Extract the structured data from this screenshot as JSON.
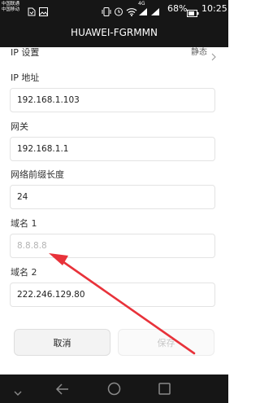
{
  "status_bar": {
    "carrier_line_1": "中国联通",
    "carrier_line_2": "中国移动",
    "network_label": "4G",
    "battery_percent": "68%",
    "time": "10:25"
  },
  "title_bar": {
    "title": "HUAWEI-FGRMMN"
  },
  "ip_setting": {
    "label": "IP 设置",
    "value": "静态"
  },
  "fields": {
    "ip_address": {
      "label": "IP 地址",
      "value": "192.168.1.103"
    },
    "gateway": {
      "label": "网关",
      "value": "192.168.1.1"
    },
    "prefix_length": {
      "label": "网络前缀长度",
      "value": "24"
    },
    "dns1": {
      "label": "域名 1",
      "placeholder": "8.8.8.8"
    },
    "dns2": {
      "label": "域名 2",
      "value": "222.246.129.80"
    }
  },
  "buttons": {
    "cancel": "取消",
    "save": "保存"
  },
  "icons": {
    "status": [
      "sim-icon",
      "gallery-icon",
      "vibrate-icon",
      "alarm-icon",
      "wifi-icon",
      "signal-icon",
      "battery-icon"
    ],
    "nav": [
      "chevron-down-icon",
      "back-icon",
      "home-icon",
      "recents-icon"
    ],
    "annotation": "red-arrow-annotation"
  },
  "colors": {
    "bars": "#161616",
    "annotation_arrow": "#e8323a"
  }
}
